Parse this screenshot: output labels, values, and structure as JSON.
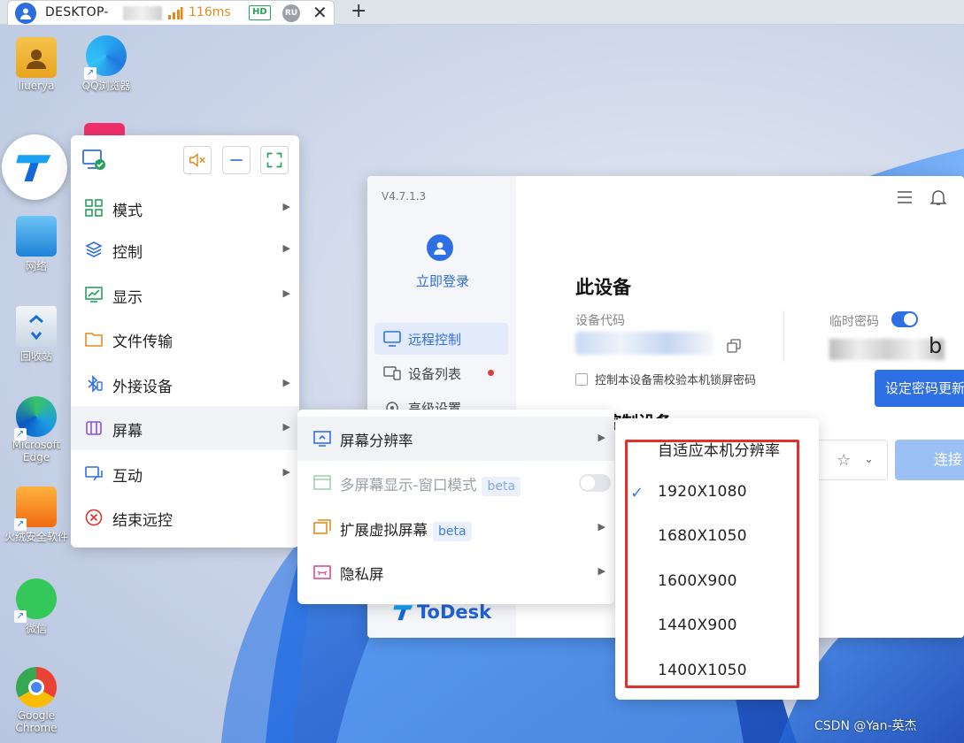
{
  "tab": {
    "host": "DESKTOP-",
    "latency": "116ms",
    "quality": "HD",
    "lang": "RU",
    "close": "✕",
    "new_tab": "+"
  },
  "desktop_icons": [
    {
      "label": "liuerya"
    },
    {
      "label": "QQ浏览器"
    },
    {
      "label": "网络"
    },
    {
      "label": "回收站"
    },
    {
      "label": "Microsoft Edge"
    },
    {
      "label": "火绒安全软件"
    },
    {
      "label": "微信"
    },
    {
      "label": "Google Chrome"
    }
  ],
  "main_menu": {
    "items": [
      {
        "label": "模式",
        "icon": "grid-icon"
      },
      {
        "label": "控制",
        "icon": "layers-icon"
      },
      {
        "label": "显示",
        "icon": "chart-icon"
      },
      {
        "label": "文件传输",
        "icon": "folder-icon"
      },
      {
        "label": "外接设备",
        "icon": "bluetooth-icon"
      },
      {
        "label": "屏幕",
        "icon": "screen-icon"
      },
      {
        "label": "互动",
        "icon": "chat-icon"
      },
      {
        "label": "结束远控",
        "icon": "close-circle-icon"
      }
    ]
  },
  "screen_menu": {
    "items": [
      {
        "label": "屏幕分辨率"
      },
      {
        "label": "多屏幕显示-窗口模式",
        "badge": "beta",
        "toggle": false
      },
      {
        "label": "扩展虚拟屏幕",
        "badge": "beta"
      },
      {
        "label": "隐私屏"
      }
    ]
  },
  "resolution_menu": {
    "items": [
      "自适应本机分辨率",
      "1920X1080",
      "1680X1050",
      "1600X900",
      "1440X900",
      "1400X1050"
    ],
    "selected": "1920X1080"
  },
  "todesk": {
    "version": "V4.7.1.3",
    "login": "立即登录",
    "nav": [
      {
        "label": "远程控制"
      },
      {
        "label": "设备列表"
      },
      {
        "label": "高级设置"
      }
    ],
    "brand": "ToDesk",
    "title": "此设备",
    "device_code_label": "设备代码",
    "temp_password_label": "临时密码",
    "lock_check": "控制本设备需校验本机锁屏密码",
    "set_password": "设定密码更新",
    "control_title": "控制设备",
    "connect": "连接",
    "password_suffix": "b"
  },
  "watermark": "CSDN @Yan-英杰",
  "colors": {
    "accent": "#2f6fe4",
    "highlight": "#e0312d",
    "latency": "#e58a1f",
    "hd": "#27a25b"
  }
}
